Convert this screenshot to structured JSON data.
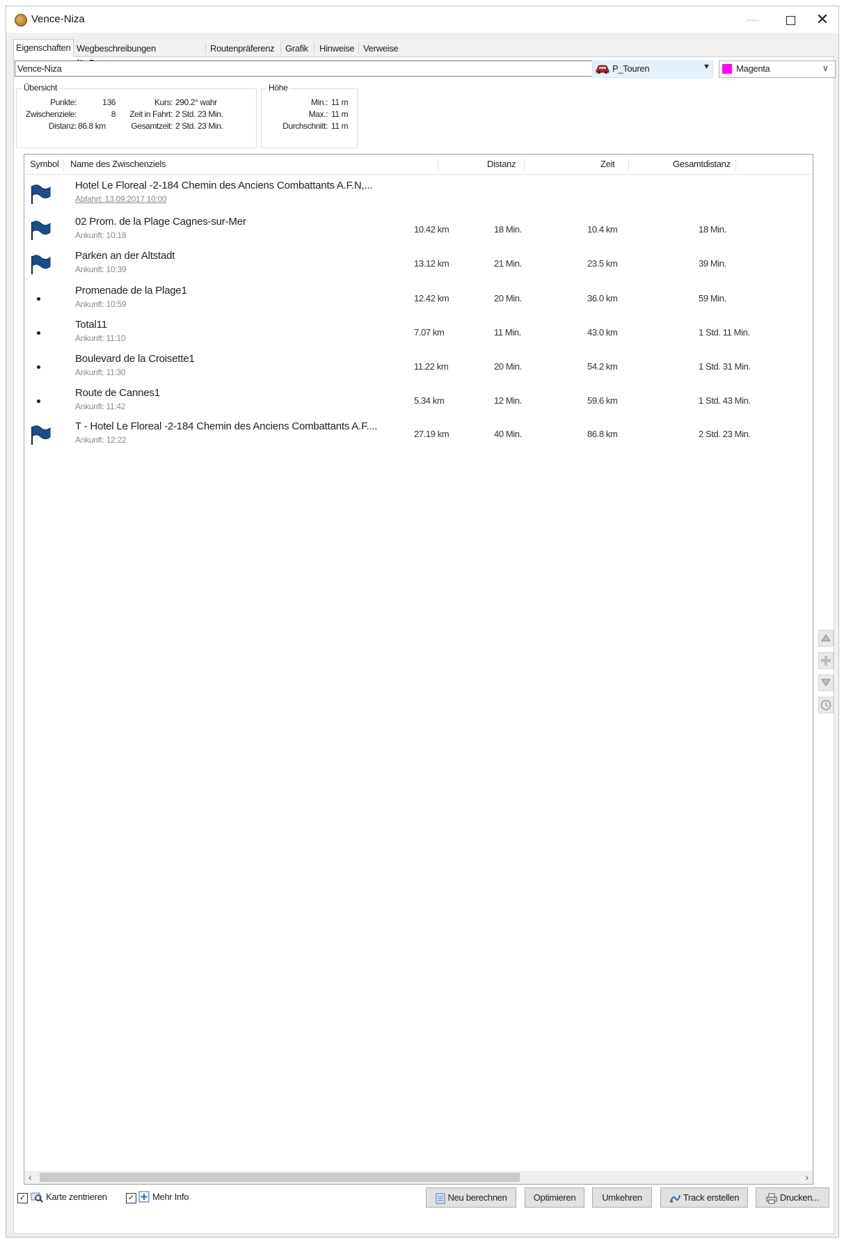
{
  "window": {
    "title": "Vence-Niza"
  },
  "tabs": [
    "Eigenschaften",
    "Wegbeschreibungen für Routen",
    "Routenpräferenz",
    "Grafik",
    "Hinweise",
    "Verweise"
  ],
  "route_name": "Vence-Niza",
  "profile": {
    "label": "P_Touren",
    "icon": "car-icon"
  },
  "color": {
    "label": "Magenta",
    "hex": "#ff00ff"
  },
  "overview": {
    "title": "Übersicht",
    "punkte_label": "Punkte:",
    "punkte": "136",
    "kurs_label": "Kurs:",
    "kurs": "290.2° wahr",
    "zwischenziele_label": "Zwischenziele:",
    "zwischenziele": "8",
    "zeit_fahrt_label": "Zeit in Fahrt:",
    "zeit_fahrt": "2 Std. 23 Min.",
    "distanz_label": "Distanz:",
    "distanz": "86.8 km",
    "gesamtzeit_label": "Gesamtzeit:",
    "gesamtzeit": "2 Std. 23 Min."
  },
  "height": {
    "title": "Höhe",
    "min_label": "Min.:",
    "min": "11 m",
    "max_label": "Max.:",
    "max": "11 m",
    "avg_label": "Durchschnitt:",
    "avg": "11 m"
  },
  "columns": [
    "Symbol",
    "Name des Zwischenziels",
    "Distanz",
    "Zeit",
    "Gesamtdistanz"
  ],
  "waypoints": [
    {
      "symbol": "flag",
      "name": "Hotel  Le Floreal -2-184 Chemin des Anciens Combattants A.F.N,...",
      "sub": "Abfahrt: 13.09.2017 10:00",
      "dist": "",
      "time": "",
      "total": "",
      "total_time": ""
    },
    {
      "symbol": "flag",
      "name": "02 Prom. de la Plage Cagnes-sur-Mer",
      "sub": "Ankunft: 10:18",
      "dist": "10.42 km",
      "time": "18 Min.",
      "total": "10.4 km",
      "total_time": "18 Min."
    },
    {
      "symbol": "flag",
      "name": "Parken an der Altstadt",
      "sub": "Ankunft: 10:39",
      "dist": "13.12 km",
      "time": "21 Min.",
      "total": "23.5 km",
      "total_time": "39 Min."
    },
    {
      "symbol": "dot",
      "name": "Promenade de la Plage1",
      "sub": "Ankunft: 10:59",
      "dist": "12.42 km",
      "time": "20 Min.",
      "total": "36.0 km",
      "total_time": "59 Min."
    },
    {
      "symbol": "dot",
      "name": "Total11",
      "sub": "Ankunft: 11:10",
      "dist": "7.07 km",
      "time": "11 Min.",
      "total": "43.0 km",
      "total_time": "1 Std. 11 Min."
    },
    {
      "symbol": "dot",
      "name": "Boulevard de la Croisette1",
      "sub": "Ankunft: 11:30",
      "dist": "11.22 km",
      "time": "20 Min.",
      "total": "54.2 km",
      "total_time": "1 Std. 31 Min."
    },
    {
      "symbol": "dot",
      "name": "Route de Cannes1",
      "sub": "Ankunft: 11:42",
      "dist": "5.34 km",
      "time": "12 Min.",
      "total": "59.6 km",
      "total_time": "1 Std. 43 Min."
    },
    {
      "symbol": "flag",
      "name": "T - Hotel  Le Floreal -2-184 Chemin des Anciens Combattants A.F....",
      "sub": "Ankunft: 12:22",
      "dist": "27.19 km",
      "time": "40 Min.",
      "total": "86.8 km",
      "total_time": "2 Std. 23 Min."
    }
  ],
  "footer": {
    "karte_zentrieren": "Karte zentrieren",
    "mehr_info": "Mehr Info",
    "buttons": [
      "Neu berechnen",
      "Optimieren",
      "Umkehren",
      "Track erstellen",
      "Drucken..."
    ]
  }
}
